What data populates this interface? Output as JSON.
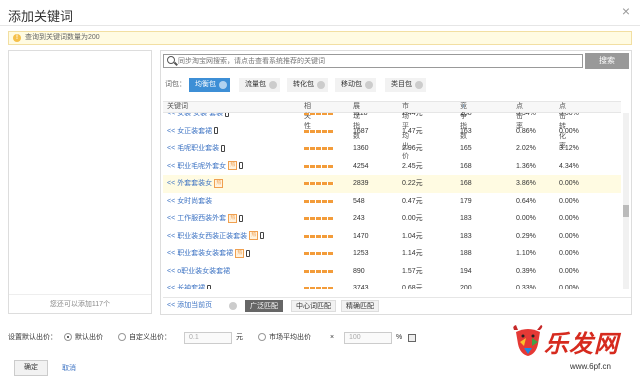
{
  "dialog": {
    "title": "添加关键词",
    "close": "×",
    "notice": "查询到关键词数量为200",
    "remaining": "您还可以添加117个"
  },
  "search": {
    "placeholder": "同步淘宝网搜索，请点击查看系统推荐的关键词",
    "button": "搜索"
  },
  "packages": {
    "label": "词包：",
    "items": [
      "均衡包",
      "流量包",
      "转化包",
      "移动包",
      "类目包"
    ],
    "active": "均衡包",
    "active_color": "#3d8fd6"
  },
  "table": {
    "headers": {
      "keyword": "关键词",
      "relevance": "相关性",
      "impressions": "展现指数",
      "avg_bid": "市场平均出价",
      "competition": "竞争指数",
      "ctr": "点击率",
      "cvr": "点击转化率"
    },
    "rows": [
      {
        "keyword": "女装 女装 套装",
        "arrow": "<<",
        "impressions": "1118",
        "avg_bid": "2.44元",
        "competition": "158",
        "ctr": "0.34%",
        "cvr": "0.00%",
        "mobile": true,
        "hot": false
      },
      {
        "keyword": "女正装套裙",
        "arrow": "<<",
        "impressions": "1687",
        "avg_bid": "1.47元",
        "competition": "163",
        "ctr": "0.86%",
        "cvr": "0.00%",
        "mobile": true,
        "hot": false
      },
      {
        "keyword": "毛呢职业套装",
        "arrow": "<<",
        "impressions": "1360",
        "avg_bid": "2.96元",
        "competition": "165",
        "ctr": "2.02%",
        "cvr": "3.12%",
        "mobile": true,
        "hot": false
      },
      {
        "keyword": "职业毛呢外套女",
        "arrow": "<<",
        "impressions": "4254",
        "avg_bid": "2.45元",
        "competition": "168",
        "ctr": "1.36%",
        "cvr": "4.34%",
        "mobile": true,
        "hot": true
      },
      {
        "keyword": "外套套装女",
        "arrow": "<<",
        "impressions": "2839",
        "avg_bid": "0.22元",
        "competition": "168",
        "ctr": "3.86%",
        "cvr": "0.00%",
        "mobile": false,
        "hot": true,
        "highlight": true
      },
      {
        "keyword": "女时尚套装",
        "arrow": "<<",
        "impressions": "548",
        "avg_bid": "0.47元",
        "competition": "179",
        "ctr": "0.64%",
        "cvr": "0.00%",
        "mobile": false,
        "hot": false
      },
      {
        "keyword": "工作服西装外套",
        "arrow": "<<",
        "impressions": "243",
        "avg_bid": "0.00元",
        "competition": "183",
        "ctr": "0.00%",
        "cvr": "0.00%",
        "mobile": true,
        "hot": true
      },
      {
        "keyword": "职业装女西装正装套装",
        "arrow": "<<",
        "impressions": "1470",
        "avg_bid": "1.04元",
        "competition": "183",
        "ctr": "0.29%",
        "cvr": "0.00%",
        "mobile": true,
        "hot": true
      },
      {
        "keyword": "职业套装女装套裙",
        "arrow": "<<",
        "impressions": "1253",
        "avg_bid": "1.14元",
        "competition": "188",
        "ctr": "1.10%",
        "cvr": "0.00%",
        "mobile": true,
        "hot": true
      },
      {
        "keyword": "o职业装女装套裙",
        "arrow": "<<",
        "impressions": "890",
        "avg_bid": "1.57元",
        "competition": "194",
        "ctr": "0.39%",
        "cvr": "0.00%",
        "mobile": false,
        "hot": false
      },
      {
        "keyword": "长袖套裙",
        "arrow": "<<",
        "impressions": "3743",
        "avg_bid": "0.68元",
        "competition": "200",
        "ctr": "0.33%",
        "cvr": "0.00%",
        "mobile": true,
        "hot": false
      }
    ],
    "mobile_icon": "phone-icon",
    "hot_label": "热"
  },
  "bottom": {
    "add_page": "<< 添加当前页",
    "match_types": [
      "广泛匹配",
      "中心词匹配",
      "精确匹配"
    ],
    "active_match": "广泛匹配"
  },
  "bid": {
    "label": "设置默认出价：",
    "default_bid": "默认出价",
    "custom_bid": "自定义出价：",
    "custom_value": "0.1",
    "unit": "元",
    "market_avg": "市场平均出价",
    "times": "×",
    "percent_value": "100",
    "percent": "%"
  },
  "actions": {
    "ok": "确定",
    "cancel": "取消"
  },
  "watermark": {
    "brand": "乐发网",
    "url": "www.6pf.cn"
  }
}
